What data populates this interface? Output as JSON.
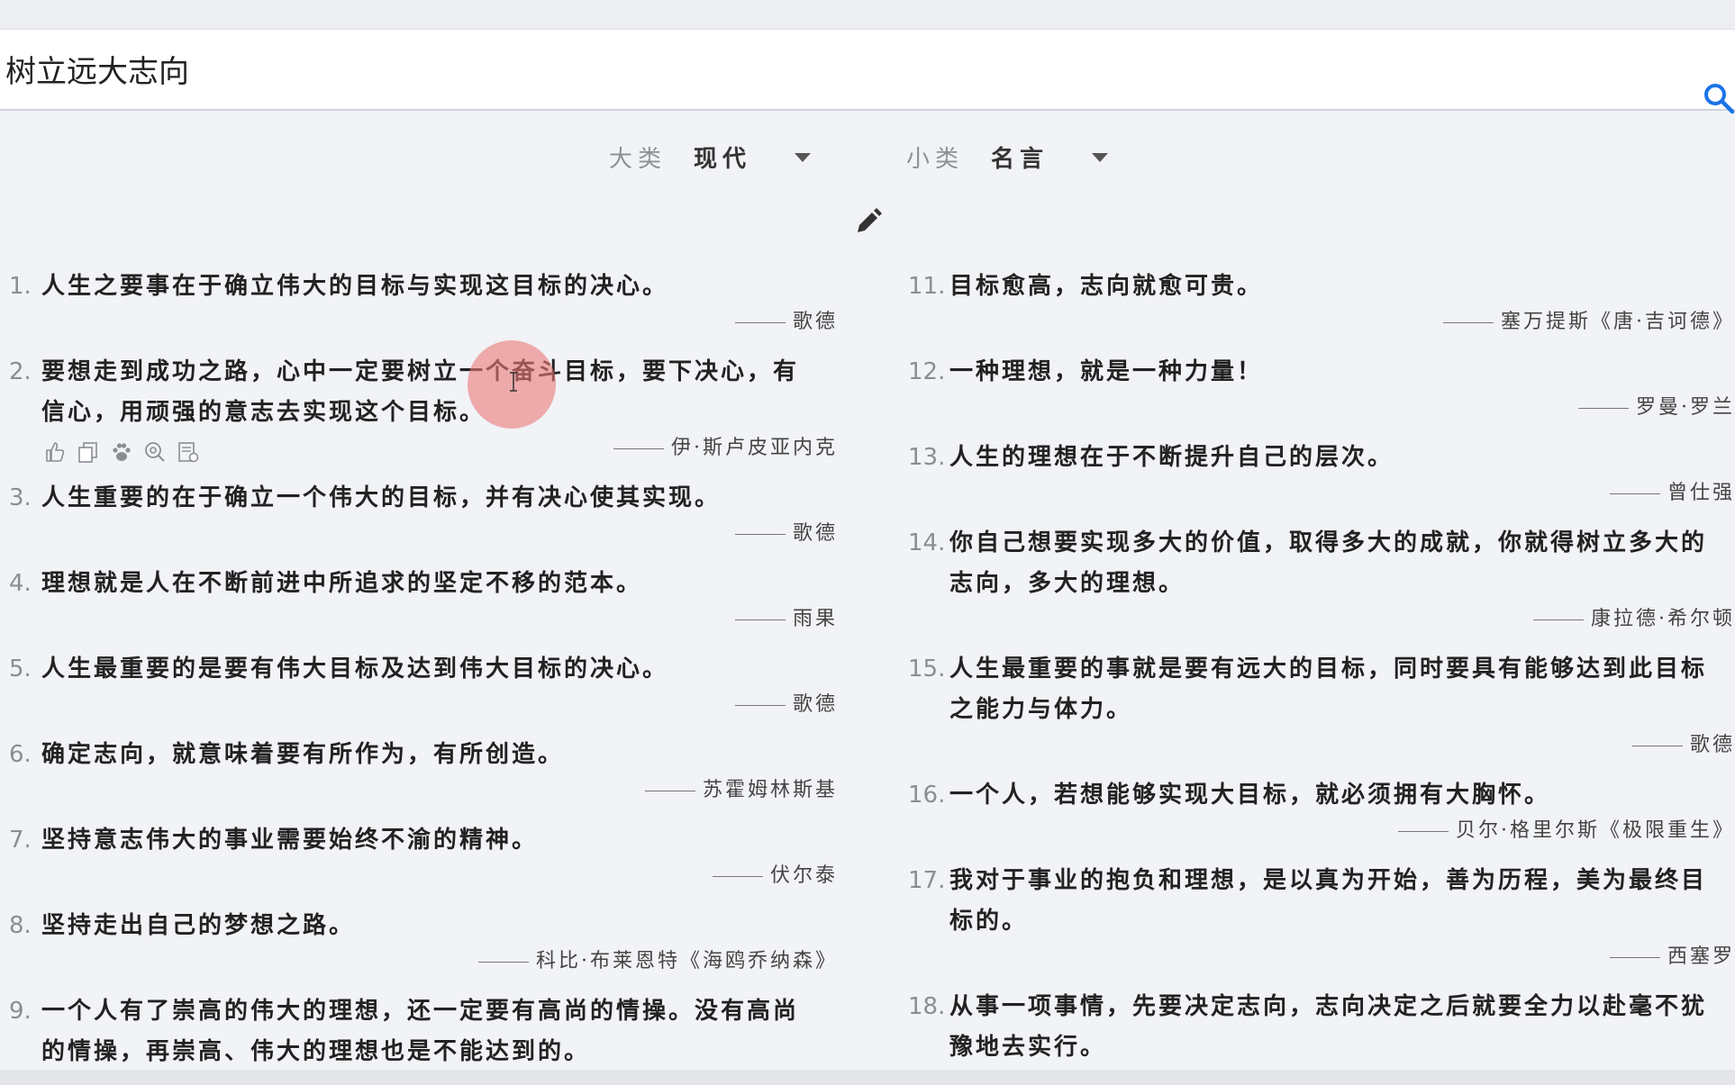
{
  "search": {
    "query": "树立远大志向"
  },
  "filters": {
    "category_label": "大类",
    "category_value": "现代",
    "subcategory_label": "小类",
    "subcategory_value": "名言"
  },
  "icons": {
    "search": "search-icon",
    "edit": "pencil-icon",
    "actions": [
      "thumbs-up-icon",
      "copy-icon",
      "paw-icon",
      "search-zoom-icon",
      "note-icon"
    ]
  },
  "colors": {
    "accent": "#1a73e8",
    "highlight": "#ec7878"
  },
  "quotes_left": [
    {
      "num": "1.",
      "lines": [
        "人生之要事在于确立伟大的目标与实现这目标的决心。"
      ],
      "author": "歌德"
    },
    {
      "num": "2.",
      "lines": [
        "要想走到成功之路，心中一定要树立一个奋斗目标，要下决心，有",
        "信心，用顽强的意志去实现这个目标。"
      ],
      "author": "伊·斯卢皮亚内克"
    },
    {
      "num": "3.",
      "lines": [
        "人生重要的在于确立一个伟大的目标，并有决心使其实现。"
      ],
      "author": "歌德"
    },
    {
      "num": "4.",
      "lines": [
        "理想就是人在不断前进中所追求的坚定不移的范本。"
      ],
      "author": "雨果"
    },
    {
      "num": "5.",
      "lines": [
        "人生最重要的是要有伟大目标及达到伟大目标的决心。"
      ],
      "author": "歌德"
    },
    {
      "num": "6.",
      "lines": [
        "确定志向，就意味着要有所作为，有所创造。"
      ],
      "author": "苏霍姆林斯基"
    },
    {
      "num": "7.",
      "lines": [
        "坚持意志伟大的事业需要始终不渝的精神。"
      ],
      "author": "伏尔泰"
    },
    {
      "num": "8.",
      "lines": [
        "坚持走出自己的梦想之路。"
      ],
      "author": "科比·布莱恩特《海鸥乔纳森》"
    },
    {
      "num": "9.",
      "lines": [
        "一个人有了崇高的伟大的理想，还一定要有高尚的情操。没有高尚",
        "的情操，再崇高、伟大的理想也是不能达到的。"
      ],
      "author": ""
    }
  ],
  "quotes_right": [
    {
      "num": "11.",
      "lines": [
        "目标愈高，志向就愈可贵。"
      ],
      "author": "塞万提斯《唐·吉诃德》"
    },
    {
      "num": "12.",
      "lines": [
        "一种理想，就是一种力量！"
      ],
      "author": "罗曼·罗兰"
    },
    {
      "num": "13.",
      "lines": [
        "人生的理想在于不断提升自己的层次。"
      ],
      "author": "曾仕强"
    },
    {
      "num": "14.",
      "lines": [
        "你自己想要实现多大的价值，取得多大的成就，你就得树立多大的",
        "志向，多大的理想。"
      ],
      "author": "康拉德·希尔顿"
    },
    {
      "num": "15.",
      "lines": [
        "人生最重要的事就是要有远大的目标，同时要具有能够达到此目标",
        "之能力与体力。"
      ],
      "author": "歌德"
    },
    {
      "num": "16.",
      "lines": [
        "一个人，若想能够实现大目标，就必须拥有大胸怀。"
      ],
      "author": "贝尔·格里尔斯《极限重生》"
    },
    {
      "num": "17.",
      "lines": [
        "我对于事业的抱负和理想，是以真为开始，善为历程，美为最终目",
        "标的。"
      ],
      "author": "西塞罗"
    },
    {
      "num": "18.",
      "lines": [
        "从事一项事情，先要决定志向，志向决定之后就要全力以赴毫不犹",
        "豫地去实行。"
      ],
      "author": ""
    }
  ]
}
